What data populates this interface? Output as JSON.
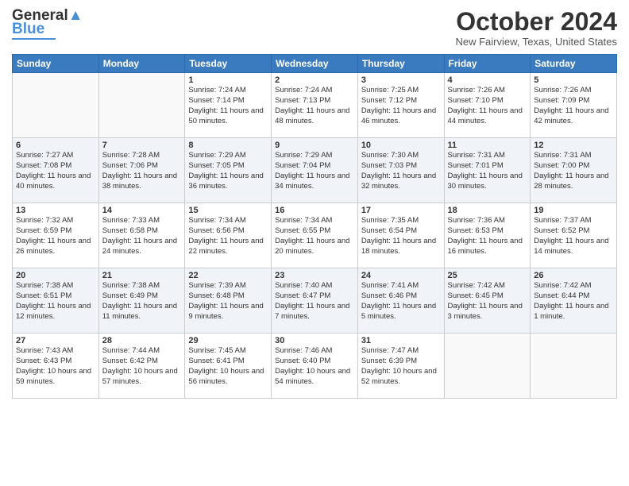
{
  "header": {
    "logo_line1": "General",
    "logo_line2": "Blue",
    "month": "October 2024",
    "location": "New Fairview, Texas, United States"
  },
  "days_of_week": [
    "Sunday",
    "Monday",
    "Tuesday",
    "Wednesday",
    "Thursday",
    "Friday",
    "Saturday"
  ],
  "weeks": [
    [
      {
        "day": "",
        "sunrise": "",
        "sunset": "",
        "daylight": ""
      },
      {
        "day": "",
        "sunrise": "",
        "sunset": "",
        "daylight": ""
      },
      {
        "day": "1",
        "sunrise": "Sunrise: 7:24 AM",
        "sunset": "Sunset: 7:14 PM",
        "daylight": "Daylight: 11 hours and 50 minutes."
      },
      {
        "day": "2",
        "sunrise": "Sunrise: 7:24 AM",
        "sunset": "Sunset: 7:13 PM",
        "daylight": "Daylight: 11 hours and 48 minutes."
      },
      {
        "day": "3",
        "sunrise": "Sunrise: 7:25 AM",
        "sunset": "Sunset: 7:12 PM",
        "daylight": "Daylight: 11 hours and 46 minutes."
      },
      {
        "day": "4",
        "sunrise": "Sunrise: 7:26 AM",
        "sunset": "Sunset: 7:10 PM",
        "daylight": "Daylight: 11 hours and 44 minutes."
      },
      {
        "day": "5",
        "sunrise": "Sunrise: 7:26 AM",
        "sunset": "Sunset: 7:09 PM",
        "daylight": "Daylight: 11 hours and 42 minutes."
      }
    ],
    [
      {
        "day": "6",
        "sunrise": "Sunrise: 7:27 AM",
        "sunset": "Sunset: 7:08 PM",
        "daylight": "Daylight: 11 hours and 40 minutes."
      },
      {
        "day": "7",
        "sunrise": "Sunrise: 7:28 AM",
        "sunset": "Sunset: 7:06 PM",
        "daylight": "Daylight: 11 hours and 38 minutes."
      },
      {
        "day": "8",
        "sunrise": "Sunrise: 7:29 AM",
        "sunset": "Sunset: 7:05 PM",
        "daylight": "Daylight: 11 hours and 36 minutes."
      },
      {
        "day": "9",
        "sunrise": "Sunrise: 7:29 AM",
        "sunset": "Sunset: 7:04 PM",
        "daylight": "Daylight: 11 hours and 34 minutes."
      },
      {
        "day": "10",
        "sunrise": "Sunrise: 7:30 AM",
        "sunset": "Sunset: 7:03 PM",
        "daylight": "Daylight: 11 hours and 32 minutes."
      },
      {
        "day": "11",
        "sunrise": "Sunrise: 7:31 AM",
        "sunset": "Sunset: 7:01 PM",
        "daylight": "Daylight: 11 hours and 30 minutes."
      },
      {
        "day": "12",
        "sunrise": "Sunrise: 7:31 AM",
        "sunset": "Sunset: 7:00 PM",
        "daylight": "Daylight: 11 hours and 28 minutes."
      }
    ],
    [
      {
        "day": "13",
        "sunrise": "Sunrise: 7:32 AM",
        "sunset": "Sunset: 6:59 PM",
        "daylight": "Daylight: 11 hours and 26 minutes."
      },
      {
        "day": "14",
        "sunrise": "Sunrise: 7:33 AM",
        "sunset": "Sunset: 6:58 PM",
        "daylight": "Daylight: 11 hours and 24 minutes."
      },
      {
        "day": "15",
        "sunrise": "Sunrise: 7:34 AM",
        "sunset": "Sunset: 6:56 PM",
        "daylight": "Daylight: 11 hours and 22 minutes."
      },
      {
        "day": "16",
        "sunrise": "Sunrise: 7:34 AM",
        "sunset": "Sunset: 6:55 PM",
        "daylight": "Daylight: 11 hours and 20 minutes."
      },
      {
        "day": "17",
        "sunrise": "Sunrise: 7:35 AM",
        "sunset": "Sunset: 6:54 PM",
        "daylight": "Daylight: 11 hours and 18 minutes."
      },
      {
        "day": "18",
        "sunrise": "Sunrise: 7:36 AM",
        "sunset": "Sunset: 6:53 PM",
        "daylight": "Daylight: 11 hours and 16 minutes."
      },
      {
        "day": "19",
        "sunrise": "Sunrise: 7:37 AM",
        "sunset": "Sunset: 6:52 PM",
        "daylight": "Daylight: 11 hours and 14 minutes."
      }
    ],
    [
      {
        "day": "20",
        "sunrise": "Sunrise: 7:38 AM",
        "sunset": "Sunset: 6:51 PM",
        "daylight": "Daylight: 11 hours and 12 minutes."
      },
      {
        "day": "21",
        "sunrise": "Sunrise: 7:38 AM",
        "sunset": "Sunset: 6:49 PM",
        "daylight": "Daylight: 11 hours and 11 minutes."
      },
      {
        "day": "22",
        "sunrise": "Sunrise: 7:39 AM",
        "sunset": "Sunset: 6:48 PM",
        "daylight": "Daylight: 11 hours and 9 minutes."
      },
      {
        "day": "23",
        "sunrise": "Sunrise: 7:40 AM",
        "sunset": "Sunset: 6:47 PM",
        "daylight": "Daylight: 11 hours and 7 minutes."
      },
      {
        "day": "24",
        "sunrise": "Sunrise: 7:41 AM",
        "sunset": "Sunset: 6:46 PM",
        "daylight": "Daylight: 11 hours and 5 minutes."
      },
      {
        "day": "25",
        "sunrise": "Sunrise: 7:42 AM",
        "sunset": "Sunset: 6:45 PM",
        "daylight": "Daylight: 11 hours and 3 minutes."
      },
      {
        "day": "26",
        "sunrise": "Sunrise: 7:42 AM",
        "sunset": "Sunset: 6:44 PM",
        "daylight": "Daylight: 11 hours and 1 minute."
      }
    ],
    [
      {
        "day": "27",
        "sunrise": "Sunrise: 7:43 AM",
        "sunset": "Sunset: 6:43 PM",
        "daylight": "Daylight: 10 hours and 59 minutes."
      },
      {
        "day": "28",
        "sunrise": "Sunrise: 7:44 AM",
        "sunset": "Sunset: 6:42 PM",
        "daylight": "Daylight: 10 hours and 57 minutes."
      },
      {
        "day": "29",
        "sunrise": "Sunrise: 7:45 AM",
        "sunset": "Sunset: 6:41 PM",
        "daylight": "Daylight: 10 hours and 56 minutes."
      },
      {
        "day": "30",
        "sunrise": "Sunrise: 7:46 AM",
        "sunset": "Sunset: 6:40 PM",
        "daylight": "Daylight: 10 hours and 54 minutes."
      },
      {
        "day": "31",
        "sunrise": "Sunrise: 7:47 AM",
        "sunset": "Sunset: 6:39 PM",
        "daylight": "Daylight: 10 hours and 52 minutes."
      },
      {
        "day": "",
        "sunrise": "",
        "sunset": "",
        "daylight": ""
      },
      {
        "day": "",
        "sunrise": "",
        "sunset": "",
        "daylight": ""
      }
    ]
  ]
}
